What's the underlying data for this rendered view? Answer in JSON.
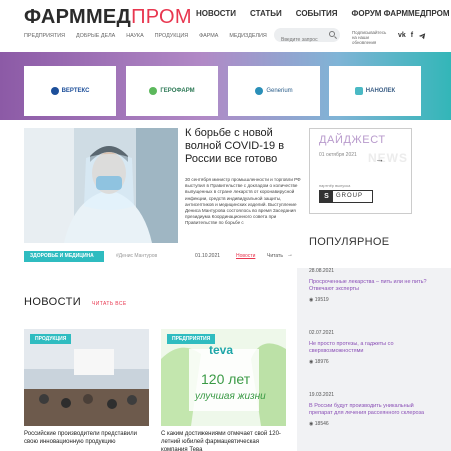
{
  "header": {
    "logo_dark": "ФАРММЕД",
    "logo_red": "ПРОМ",
    "main_nav": [
      "НОВОСТИ",
      "СТАТЬИ",
      "СОБЫТИЯ",
      "ФОРУМ ФАРММЕДПРОМ"
    ],
    "sub_nav": [
      "ПРЕДПРИЯТИЯ",
      "ДОБРЫЕ ДЕЛА",
      "НАУКА",
      "ПРОДУКЦИЯ",
      "ФАРМА",
      "МЕДИЗДЕЛИЯ"
    ],
    "search_placeholder": "Введите запрос",
    "subscribe_text": "Подписывайтесь на наши обновления",
    "socials": [
      "vk-icon",
      "facebook-icon",
      "telegram-icon"
    ]
  },
  "partners": [
    {
      "name": "ВЕРТЕКС",
      "color": "#1d4f9a"
    },
    {
      "name": "ГЕРОФАРМ",
      "color": "#2e7a57"
    },
    {
      "name": "Generium",
      "color": "#2a5d8a"
    },
    {
      "name": "НАНОЛЕК",
      "color": "#3c5f86"
    }
  ],
  "hero": {
    "title": "К борьбе с новой волной COVID-19 в России все готово",
    "text": "30 сентября министр промышленности и торговли РФ выступил в Правительстве с докладом о количестве выпущенных в стране лекарств от коронавирусной инфекции, средств индивидуальной защиты, антисептиков и медицинских изделий. Выступление Дениса Мантурова состоялось во время Заседания президиума Координационного совета при Правительстве по борьбе с",
    "tag": "ЗДОРОВЬЕ И МЕДИЦИНА",
    "author": "#Денис Мантуров",
    "date": "01.10.2021",
    "category": "Новости",
    "read": "Читать"
  },
  "digest": {
    "title": "ДАЙДЖЕСТ",
    "date": "01 октября 2021",
    "sponsor_label": "партнёр выпуска",
    "sponsor_s": "S",
    "sponsor_name": "GROUP",
    "watermark": "NEWS"
  },
  "popular": {
    "title": "ПОПУЛЯРНОЕ",
    "items": [
      {
        "date": "28.08.2021",
        "title": "Просроченные лекарства – пить или не пить? Отвечают эксперты",
        "views": "19519"
      },
      {
        "date": "02.07.2021",
        "title": "Не просто протезы, а гаджеты со сверхвозможностями",
        "views": "18976"
      },
      {
        "date": "19.03.2021",
        "title": "В России будут производить уникальный препарат для лечения рассеянного склероза",
        "views": "18546"
      }
    ]
  },
  "news": {
    "title": "НОВОСТИ",
    "read_all": "ЧИТАТЬ ВСЕ",
    "cards": [
      {
        "badge": "ПРОДУКЦИЯ",
        "title": "Российские производители представили свою инновационную продукцию"
      },
      {
        "badge": "ПРЕДПРИЯТИЯ",
        "title": "С каким достижениями отмечает свой 120-летний юбилей фармацевтическая компания Тева",
        "teva_brand": "teva",
        "teva_years": "120 лет",
        "teva_slogan": "улучшая жизни"
      }
    ]
  },
  "colors": {
    "accent_red": "#e8364f",
    "accent_teal": "#2fbcc0",
    "accent_purple": "#8a4fb6"
  }
}
